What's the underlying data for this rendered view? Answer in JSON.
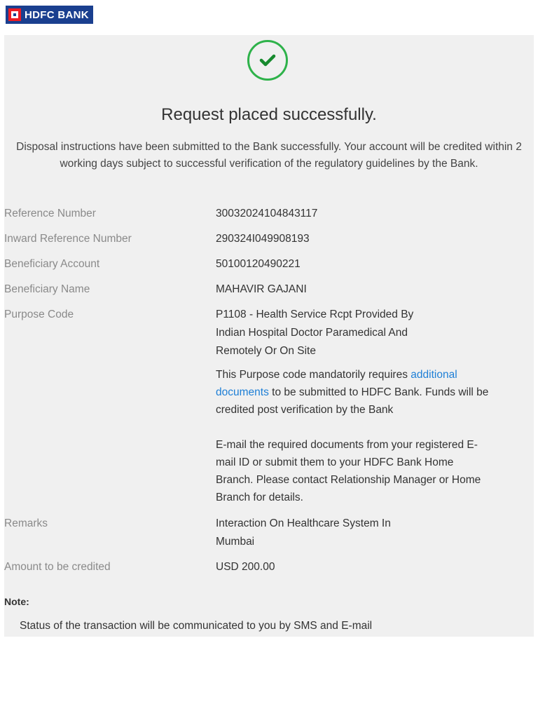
{
  "header": {
    "logo_text": "HDFC BANK"
  },
  "success": {
    "title": "Request placed successfully.",
    "description": "Disposal instructions have been submitted to the Bank successfully. Your account will be credited within 2 working days subject to successful verification of the regulatory guidelines by the Bank."
  },
  "details": {
    "reference_number": {
      "label": "Reference Number",
      "value": "30032024104843117"
    },
    "inward_reference_number": {
      "label": "Inward Reference Number",
      "value": "290324I049908193"
    },
    "beneficiary_account": {
      "label": "Beneficiary Account",
      "value": "50100120490221"
    },
    "beneficiary_name": {
      "label": "Beneficiary Name",
      "value": "MAHAVIR GAJANI"
    },
    "purpose_code": {
      "label": "Purpose Code",
      "value": "P1108 - Health Service Rcpt Provided By Indian Hospital Doctor Paramedical And Remotely Or On Site",
      "info_before": "This Purpose code mandatorily requires ",
      "info_link": "additional documents",
      "info_after": " to be submitted to HDFC Bank. Funds will be credited post verification by the Bank",
      "email_info": "E-mail the required documents from your registered E-mail ID or submit them to your HDFC Bank Home Branch. Please contact Relationship Manager or Home Branch for details."
    },
    "remarks": {
      "label": "Remarks",
      "value": "Interaction On Healthcare System In Mumbai"
    },
    "amount": {
      "label": "Amount to be credited",
      "value": "USD 200.00"
    }
  },
  "note": {
    "heading": "Note:",
    "text": "Status of the transaction will be communicated to you by SMS and E-mail"
  }
}
